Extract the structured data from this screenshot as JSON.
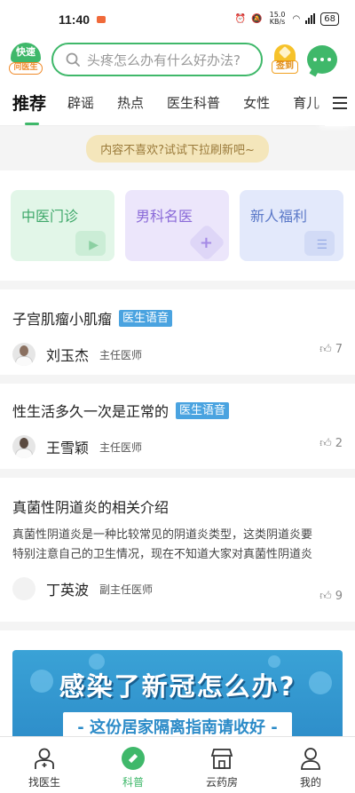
{
  "status": {
    "time": "11:40",
    "speed": "15.0 KB/s",
    "battery": "68"
  },
  "search": {
    "placeholder": "头疼怎么办有什么好办法?"
  },
  "logo": {
    "top": "快速",
    "bottom": "问医生"
  },
  "checkin": {
    "label": "签到"
  },
  "tabs": [
    "推荐",
    "辟谣",
    "热点",
    "医生科普",
    "女性",
    "育儿"
  ],
  "refresh_hint": "内容不喜欢?试试下拉刷新吧~",
  "categories": [
    "中医门诊",
    "男科名医",
    "新人福利"
  ],
  "articles": [
    {
      "title": "子宫肌瘤小肌瘤",
      "badge": "医生语音",
      "doctor": "刘玉杰",
      "role": "主任医师",
      "likes": "7"
    },
    {
      "title": "性生活多久一次是正常的",
      "badge": "医生语音",
      "doctor": "王雪颖",
      "role": "主任医师",
      "likes": "2"
    },
    {
      "title": "真菌性阴道炎的相关介绍",
      "summary_line1": "真菌性阴道炎是一种比较常见的阴道炎类型，这类阴道炎要",
      "summary_line2": "特别注意自己的卫生情况，现在不知道大家对真菌性阴道炎",
      "doctor": "丁英波",
      "role": "副主任医师",
      "likes": "9"
    }
  ],
  "banner": {
    "title": "感染了新冠怎么办?",
    "subtitle": "- 这份居家隔离指南请收好 -"
  },
  "bottom_nav": [
    "找医生",
    "科普",
    "云药房",
    "我的"
  ],
  "colors": {
    "brand_green": "#3fb86a",
    "badge_blue": "#4aa3e0",
    "banner_blue": "#2c8bc8"
  }
}
